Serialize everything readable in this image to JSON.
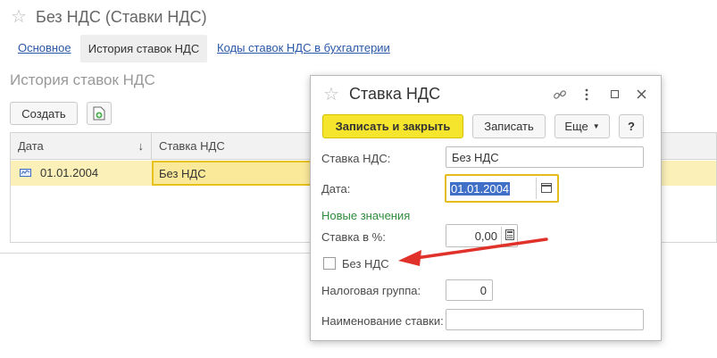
{
  "window": {
    "title": "Без НДС (Ставки НДС)"
  },
  "tabs": [
    {
      "label": "Основное"
    },
    {
      "label": "История ставок НДС"
    },
    {
      "label": "Коды ставок НДС в бухгалтерии"
    }
  ],
  "section": {
    "title": "История ставок НДС"
  },
  "toolbar": {
    "create_label": "Создать"
  },
  "table": {
    "columns": [
      "Дата",
      "Ставка НДС"
    ],
    "sort_indicator": "↓",
    "rows": [
      {
        "date": "01.01.2004",
        "rate": "Без НДС"
      }
    ]
  },
  "dialog": {
    "title": "Ставка НДС",
    "buttons": {
      "save_close": "Записать и закрыть",
      "save": "Записать",
      "more": "Еще",
      "help": "?"
    },
    "fields": {
      "rate_label": "Ставка НДС:",
      "rate_value": "Без НДС",
      "date_label": "Дата:",
      "date_value": "01.01.2004",
      "new_values": "Новые значения",
      "percent_label": "Ставка в %:",
      "percent_value": "0,00",
      "no_vat_label": "Без НДС",
      "tax_group_label": "Налоговая группа:",
      "tax_group_value": "0",
      "rate_name_label": "Наименование ставки:",
      "rate_name_value": ""
    }
  },
  "colors": {
    "accent_yellow": "#f6e52d",
    "link_blue": "#2a58a8",
    "arrow_red": "#e0322b",
    "green_text": "#2e8b3c"
  }
}
